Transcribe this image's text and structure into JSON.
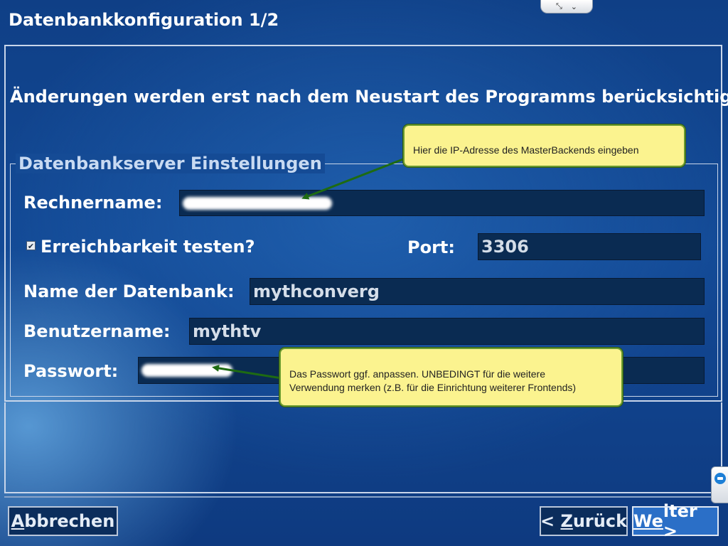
{
  "window": {
    "title": "Datenbankkonfiguration 1/2",
    "notice": "Änderungen werden erst nach dem Neustart des Programms berücksichtigt."
  },
  "pull_tab": {
    "icons": [
      "resize-icon",
      "chevron-down-icon"
    ]
  },
  "group": {
    "title": "Datenbankserver Einstellungen",
    "hostname_label": "Rechnername:",
    "hostname_value_redacted": true,
    "reachability_checkbox_label": "Erreichbarkeit testen?",
    "reachability_checked": true,
    "port_label": "Port:",
    "port_value": "3306",
    "dbname_label": "Name der Datenbank:",
    "dbname_value": "mythconverg",
    "username_label": "Benutzername:",
    "username_value": "mythtv",
    "password_label": "Passwort:",
    "password_value_redacted": true
  },
  "buttons": {
    "cancel_accel": "A",
    "cancel_rest": "bbrechen",
    "back_prefix": "< ",
    "back_accel": "Z",
    "back_rest": "urück",
    "next_accel": "We",
    "next_rest": "iter >"
  },
  "annotations": {
    "hostname_hint": "Hier die IP-Adresse des MasterBackends eingeben",
    "password_hint_line1": "Das Passwort ggf. anpassen. UNBEDINGT für die weitere",
    "password_hint_line2": "Verwendung merken (z.B. für die Einrichtung weiterer Frontends)"
  },
  "colors": {
    "background": "#134a96",
    "field_bg": "#0a2b52",
    "callout_bg": "#fbf38f",
    "arrow": "#1e6b12"
  }
}
